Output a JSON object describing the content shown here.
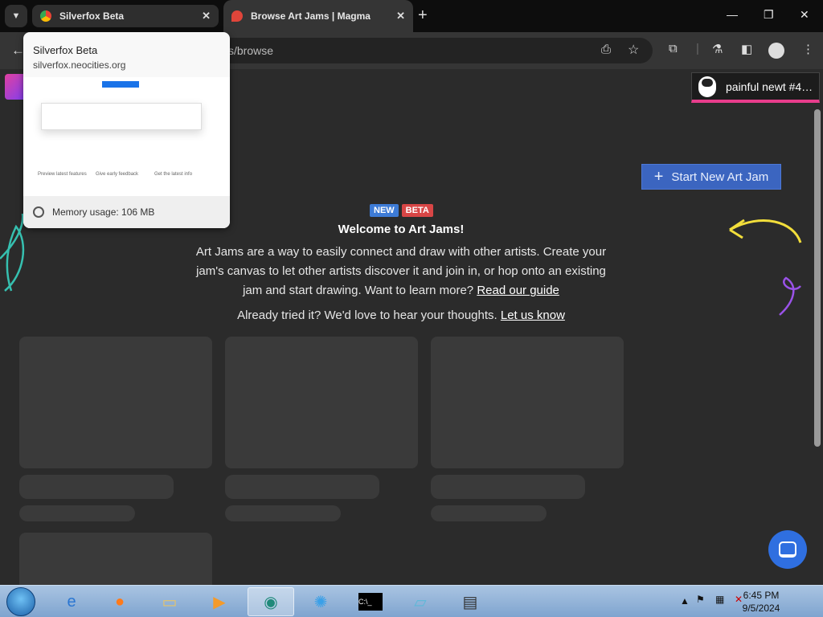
{
  "browser": {
    "tabs": [
      {
        "title": "Silverfox Beta",
        "favicon": "chrome-icon"
      },
      {
        "title": "Browse Art Jams | Magma",
        "favicon": "magma-icon"
      }
    ],
    "address_text": "s/browse"
  },
  "tab_hover_card": {
    "title": "Silverfox Beta",
    "url": "silverfox.neocities.org",
    "memory": "Memory usage: 106 MB",
    "preview_sections": [
      "Preview latest features",
      "Give early feedback",
      "Get the latest info"
    ]
  },
  "page": {
    "user_chip": "painful newt #4…",
    "start_button": "Start New Art Jam",
    "badge_new": "NEW",
    "badge_beta": "BETA",
    "welcome_title": "Welcome to Art Jams!",
    "intro_text": "Art Jams are a way to easily connect and draw with other artists. Create your jam's canvas to let other artists discover it and join in, or hop onto an existing jam and start drawing. Want to learn more?",
    "intro_link": "Read our guide",
    "feedback_text": "Already tried it? We'd love to hear your thoughts.",
    "feedback_link": "Let us know"
  },
  "taskbar": {
    "time": "6:45 PM",
    "date": "9/5/2024"
  },
  "colors": {
    "accent_blue": "#3b65c0",
    "badge_new": "#3d7bd6",
    "badge_beta": "#d84646",
    "user_chip_border": "#e83d8c"
  }
}
